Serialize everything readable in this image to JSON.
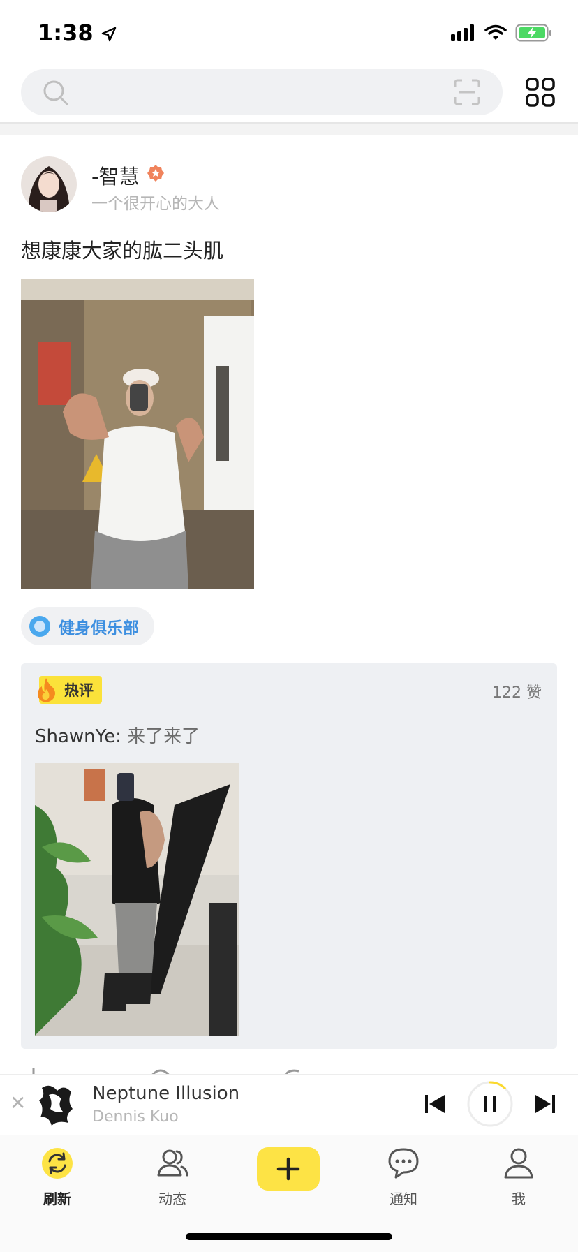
{
  "status_bar": {
    "time": "1:38"
  },
  "feed_post": {
    "user": {
      "name": "-智慧",
      "signature": "一个很开心的大人"
    },
    "text": "想康康大家的肱二头肌",
    "topic": "健身俱乐部",
    "hot_comment": {
      "tag": "热评",
      "likes": "122 赞",
      "author": "ShawnYe:",
      "text": " 来了来了"
    }
  },
  "music_player": {
    "title": "Neptune Illusion",
    "artist": "Dennis Kuo",
    "progress": 0.12
  },
  "tab_bar": {
    "items": [
      {
        "label": "刷新",
        "icon": "refresh-icon",
        "active": true
      },
      {
        "label": "动态",
        "icon": "friends-icon"
      },
      {
        "label": "通知",
        "icon": "chat-bubble-icon"
      },
      {
        "label": "我",
        "icon": "person-icon"
      }
    ]
  },
  "colors": {
    "accent_yellow": "#fde345",
    "topic_blue": "#3d8fe0",
    "battery_green": "#4cd964"
  }
}
